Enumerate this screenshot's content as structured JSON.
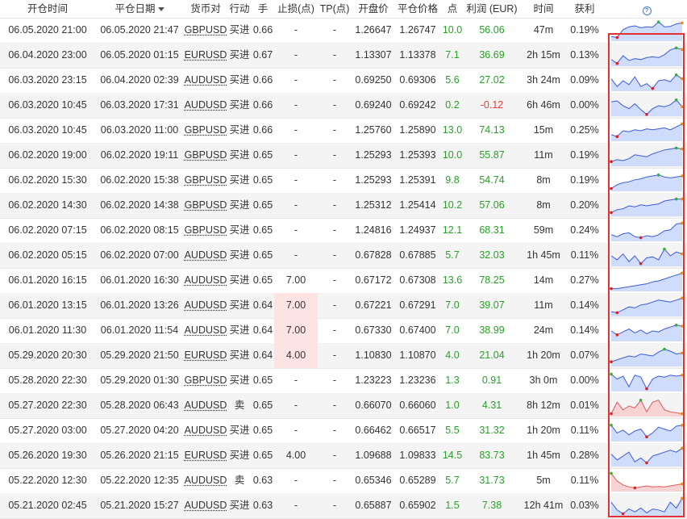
{
  "header": {
    "open_time": "开仓时间",
    "close_date": "平仓日期",
    "pair": "货币对",
    "action": "行动",
    "lots": "手",
    "sl": "止损(点)",
    "tp": "TP(点)",
    "open_price": "开盘价",
    "close_price": "平仓价格",
    "pips": "点",
    "profit": "利润 (EUR)",
    "duration": "时间",
    "gain": "获利",
    "help_glyph": "?"
  },
  "colors": {
    "positive": "#27a127",
    "negative": "#e53b3b",
    "highlight": "#fde3e3",
    "spark_fill": "#cfdcfb",
    "spark_line": "#3b5bdb",
    "spark_loss_fill": "#f7d3d3",
    "spark_loss_line": "#e05a5a",
    "frame": "#e23232"
  },
  "trades": [
    {
      "open": "06.05.2020 21:00",
      "close": "06.05.2020 21:47",
      "pair": "GBPUSD",
      "action": "买进",
      "lots": "0.66",
      "sl": "-",
      "tp": "-",
      "open_price": "1.26647",
      "close_price": "1.26747",
      "pips": "10.0",
      "profit": "56.06",
      "duration": "47m",
      "gain": "0.19%",
      "sign": "pos",
      "sl_hl": false,
      "spark": [
        0.2,
        0.15,
        0.55,
        0.7,
        0.75,
        0.65,
        0.7,
        0.68,
        0.95,
        0.7,
        0.72,
        0.85,
        0.9
      ]
    },
    {
      "open": "06.04.2020 23:00",
      "close": "06.05.2020 01:15",
      "pair": "EURUSD",
      "action": "买进",
      "lots": "0.67",
      "sl": "-",
      "tp": "-",
      "open_price": "1.13307",
      "close_price": "1.13378",
      "pips": "7.1",
      "profit": "36.69",
      "duration": "2h 15m",
      "gain": "0.13%",
      "sign": "pos",
      "sl_hl": false,
      "spark": [
        0.3,
        0.1,
        0.5,
        0.25,
        0.35,
        0.3,
        0.4,
        0.45,
        0.4,
        0.55,
        0.8,
        0.9,
        0.82
      ]
    },
    {
      "open": "06.03.2020 23:15",
      "close": "06.04.2020 02:39",
      "pair": "AUDUSD",
      "action": "买进",
      "lots": "0.66",
      "sl": "-",
      "tp": "-",
      "open_price": "0.69250",
      "close_price": "0.69306",
      "pips": "5.6",
      "profit": "27.02",
      "duration": "3h 24m",
      "gain": "0.09%",
      "sign": "pos",
      "sl_hl": false,
      "spark": [
        0.6,
        0.2,
        0.5,
        0.3,
        0.7,
        0.2,
        0.35,
        0.1,
        0.5,
        0.55,
        0.45,
        0.8,
        0.6
      ]
    },
    {
      "open": "06.03.2020 10:45",
      "close": "06.03.2020 17:31",
      "pair": "AUDUSD",
      "action": "买进",
      "lots": "0.66",
      "sl": "-",
      "tp": "-",
      "open_price": "0.69240",
      "close_price": "0.69242",
      "pips": "0.2",
      "profit": "-0.12",
      "duration": "6h 46m",
      "gain": "0.00%",
      "sign": "neg",
      "sl_hl": false,
      "spark": [
        0.7,
        0.75,
        0.5,
        0.35,
        0.6,
        0.3,
        0.05,
        0.35,
        0.5,
        0.45,
        0.55,
        0.8,
        0.45
      ]
    },
    {
      "open": "06.03.2020 10:45",
      "close": "06.03.2020 11:00",
      "pair": "GBPUSD",
      "action": "买进",
      "lots": "0.66",
      "sl": "-",
      "tp": "-",
      "open_price": "1.25760",
      "close_price": "1.25890",
      "pips": "13.0",
      "profit": "74.13",
      "duration": "15m",
      "gain": "0.25%",
      "sign": "pos",
      "sl_hl": false,
      "spark": [
        0.3,
        0.2,
        0.5,
        0.45,
        0.55,
        0.5,
        0.6,
        0.55,
        0.6,
        0.65,
        0.55,
        0.7,
        0.85
      ]
    },
    {
      "open": "06.02.2020 19:00",
      "close": "06.02.2020 19:11",
      "pair": "GBPUSD",
      "action": "买进",
      "lots": "0.65",
      "sl": "-",
      "tp": "-",
      "open_price": "1.25293",
      "close_price": "1.25393",
      "pips": "10.0",
      "profit": "55.87",
      "duration": "11m",
      "gain": "0.19%",
      "sign": "pos",
      "sl_hl": false,
      "spark": [
        0.2,
        0.3,
        0.25,
        0.35,
        0.55,
        0.5,
        0.45,
        0.6,
        0.7,
        0.8,
        0.85,
        0.9,
        0.85
      ]
    },
    {
      "open": "06.02.2020 15:30",
      "close": "06.02.2020 15:38",
      "pair": "GBPUSD",
      "action": "买进",
      "lots": "0.65",
      "sl": "-",
      "tp": "-",
      "open_price": "1.25293",
      "close_price": "1.25391",
      "pips": "9.8",
      "profit": "54.74",
      "duration": "8m",
      "gain": "0.19%",
      "sign": "pos",
      "sl_hl": false,
      "spark": [
        0.1,
        0.3,
        0.4,
        0.45,
        0.55,
        0.6,
        0.7,
        0.75,
        0.8,
        0.7,
        0.65,
        0.7,
        0.75
      ]
    },
    {
      "open": "06.02.2020 14:30",
      "close": "06.02.2020 14:38",
      "pair": "GBPUSD",
      "action": "买进",
      "lots": "0.65",
      "sl": "-",
      "tp": "-",
      "open_price": "1.25312",
      "close_price": "1.25414",
      "pips": "10.2",
      "profit": "57.06",
      "duration": "8m",
      "gain": "0.20%",
      "sign": "pos",
      "sl_hl": false,
      "spark": [
        0.15,
        0.3,
        0.35,
        0.5,
        0.45,
        0.55,
        0.5,
        0.55,
        0.6,
        0.75,
        0.8,
        0.85,
        0.85
      ]
    },
    {
      "open": "06.02.2020 07:15",
      "close": "06.02.2020 08:15",
      "pair": "GBPUSD",
      "action": "买进",
      "lots": "0.65",
      "sl": "-",
      "tp": "-",
      "open_price": "1.24816",
      "close_price": "1.24937",
      "pips": "12.1",
      "profit": "68.31",
      "duration": "59m",
      "gain": "0.24%",
      "sign": "pos",
      "sl_hl": false,
      "spark": [
        0.3,
        0.2,
        0.35,
        0.4,
        0.2,
        0.15,
        0.25,
        0.2,
        0.3,
        0.5,
        0.55,
        0.85,
        0.9
      ]
    },
    {
      "open": "06.02.2020 05:15",
      "close": "06.02.2020 07:00",
      "pair": "AUDUSD",
      "action": "买进",
      "lots": "0.65",
      "sl": "-",
      "tp": "-",
      "open_price": "0.67828",
      "close_price": "0.67885",
      "pips": "5.7",
      "profit": "32.03",
      "duration": "1h 45m",
      "gain": "0.11%",
      "sign": "pos",
      "sl_hl": false,
      "spark": [
        0.5,
        0.3,
        0.6,
        0.2,
        0.5,
        0.1,
        0.4,
        0.45,
        0.3,
        0.85,
        0.5,
        0.7,
        0.6
      ]
    },
    {
      "open": "06.01.2020 16:15",
      "close": "06.01.2020 16:30",
      "pair": "AUDUSD",
      "action": "买进",
      "lots": "0.65",
      "sl": "7.00",
      "tp": "-",
      "open_price": "0.67172",
      "close_price": "0.67308",
      "pips": "13.6",
      "profit": "78.25",
      "duration": "14m",
      "gain": "0.27%",
      "sign": "pos",
      "sl_hl": false,
      "spark": [
        0.1,
        0.1,
        0.15,
        0.2,
        0.25,
        0.3,
        0.35,
        0.45,
        0.5,
        0.6,
        0.7,
        0.8,
        0.9
      ]
    },
    {
      "open": "06.01.2020 13:15",
      "close": "06.01.2020 13:26",
      "pair": "AUDUSD",
      "action": "买进",
      "lots": "0.64",
      "sl": "7.00",
      "tp": "-",
      "open_price": "0.67221",
      "close_price": "0.67291",
      "pips": "7.0",
      "profit": "39.07",
      "duration": "11m",
      "gain": "0.14%",
      "sign": "pos",
      "sl_hl": true,
      "spark": [
        0.2,
        0.15,
        0.3,
        0.45,
        0.4,
        0.55,
        0.6,
        0.7,
        0.8,
        0.75,
        0.7,
        0.8,
        0.9
      ]
    },
    {
      "open": "06.01.2020 11:30",
      "close": "06.01.2020 11:54",
      "pair": "AUDUSD",
      "action": "买进",
      "lots": "0.64",
      "sl": "7.00",
      "tp": "-",
      "open_price": "0.67330",
      "close_price": "0.67400",
      "pips": "7.0",
      "profit": "38.99",
      "duration": "24m",
      "gain": "0.14%",
      "sign": "pos",
      "sl_hl": true,
      "spark": [
        0.5,
        0.3,
        0.45,
        0.6,
        0.4,
        0.55,
        0.35,
        0.5,
        0.45,
        0.6,
        0.7,
        0.8,
        0.75
      ]
    },
    {
      "open": "05.29.2020 20:30",
      "close": "05.29.2020 21:50",
      "pair": "EURUSD",
      "action": "买进",
      "lots": "0.64",
      "sl": "4.00",
      "tp": "-",
      "open_price": "1.10830",
      "close_price": "1.10870",
      "pips": "4.0",
      "profit": "21.04",
      "duration": "1h 20m",
      "gain": "0.07%",
      "sign": "pos",
      "sl_hl": true,
      "spark": [
        0.2,
        0.3,
        0.4,
        0.5,
        0.45,
        0.6,
        0.55,
        0.5,
        0.7,
        0.85,
        0.75,
        0.6,
        0.65
      ]
    },
    {
      "open": "05.28.2020 22:30",
      "close": "05.29.2020 01:30",
      "pair": "GBPUSD",
      "action": "买进",
      "lots": "0.65",
      "sl": "-",
      "tp": "-",
      "open_price": "1.23223",
      "close_price": "1.23236",
      "pips": "1.3",
      "profit": "0.91",
      "duration": "3h 0m",
      "gain": "0.00%",
      "sign": "pos",
      "sl_hl": false,
      "spark": [
        0.85,
        0.6,
        0.75,
        0.2,
        0.8,
        0.7,
        0.1,
        0.6,
        0.75,
        0.7,
        0.8,
        0.75,
        0.8
      ]
    },
    {
      "open": "05.27.2020 22:30",
      "close": "05.28.2020 06:43",
      "pair": "AUDUSD",
      "action": "卖",
      "lots": "0.65",
      "sl": "-",
      "tp": "-",
      "open_price": "0.66070",
      "close_price": "0.66060",
      "pips": "1.0",
      "profit": "4.31",
      "duration": "8h 12m",
      "gain": "0.01%",
      "sign": "pos",
      "sl_hl": false,
      "loss_chart": true,
      "spark": [
        0.1,
        0.7,
        0.3,
        0.5,
        0.4,
        0.8,
        0.2,
        0.7,
        0.8,
        0.3,
        0.2,
        0.15,
        0.1
      ]
    },
    {
      "open": "05.27.2020 03:00",
      "close": "05.27.2020 04:20",
      "pair": "AUDUSD",
      "action": "买进",
      "lots": "0.65",
      "sl": "-",
      "tp": "-",
      "open_price": "0.66462",
      "close_price": "0.66517",
      "pips": "5.5",
      "profit": "31.32",
      "duration": "1h 20m",
      "gain": "0.11%",
      "sign": "pos",
      "sl_hl": false,
      "spark": [
        0.8,
        0.4,
        0.55,
        0.3,
        0.5,
        0.6,
        0.2,
        0.4,
        0.7,
        0.6,
        0.5,
        0.75,
        0.8
      ]
    },
    {
      "open": "05.26.2020 19:30",
      "close": "05.26.2020 21:15",
      "pair": "EURUSD",
      "action": "买进",
      "lots": "0.65",
      "sl": "4.00",
      "tp": "-",
      "open_price": "1.09688",
      "close_price": "1.09833",
      "pips": "14.5",
      "profit": "83.73",
      "duration": "1h 45m",
      "gain": "0.28%",
      "sign": "pos",
      "sl_hl": false,
      "spark": [
        0.6,
        0.3,
        0.5,
        0.7,
        0.2,
        0.4,
        0.15,
        0.5,
        0.6,
        0.7,
        0.8,
        0.7,
        0.9
      ]
    },
    {
      "open": "05.22.2020 12:30",
      "close": "05.22.2020 12:35",
      "pair": "AUDUSD",
      "action": "卖",
      "lots": "0.63",
      "sl": "-",
      "tp": "-",
      "open_price": "0.65346",
      "close_price": "0.65289",
      "pips": "5.7",
      "profit": "31.73",
      "duration": "5m",
      "gain": "0.11%",
      "sign": "pos",
      "sl_hl": false,
      "loss_chart": true,
      "spark": [
        0.9,
        0.5,
        0.3,
        0.2,
        0.15,
        0.2,
        0.25,
        0.2,
        0.22,
        0.2,
        0.25,
        0.3,
        0.35
      ]
    },
    {
      "open": "05.21.2020 02:45",
      "close": "05.21.2020 15:27",
      "pair": "AUDUSD",
      "action": "买进",
      "lots": "0.63",
      "sl": "-",
      "tp": "-",
      "open_price": "0.65887",
      "close_price": "0.65902",
      "pips": "1.5",
      "profit": "7.38",
      "duration": "12h 41m",
      "gain": "0.03%",
      "sign": "pos",
      "sl_hl": false,
      "spark": [
        0.7,
        0.3,
        0.1,
        0.35,
        0.2,
        0.4,
        0.15,
        0.35,
        0.3,
        0.2,
        0.7,
        0.4,
        0.9
      ]
    }
  ]
}
